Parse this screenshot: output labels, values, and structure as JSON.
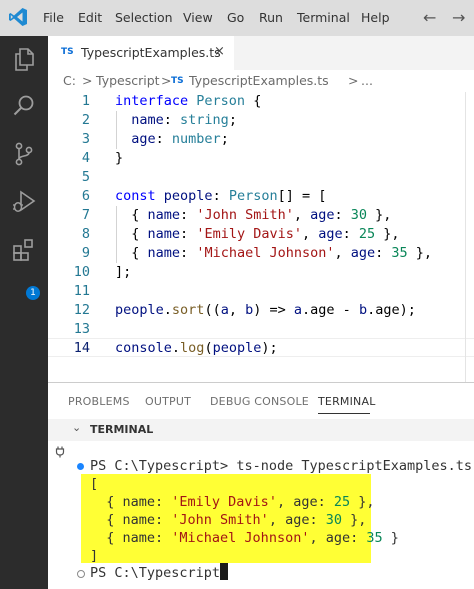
{
  "menu": {
    "items": [
      "File",
      "Edit",
      "Selection",
      "View",
      "Go",
      "Run",
      "Terminal",
      "Help"
    ],
    "back_icon": "arrow-left-icon",
    "forward_icon": "arrow-right-icon"
  },
  "activity_bar": {
    "icons": [
      "files-icon",
      "search-icon",
      "source-control-icon",
      "run-debug-icon",
      "extensions-icon"
    ],
    "extensions_badge": "1"
  },
  "tab": {
    "badge": "TS",
    "label": "TypescriptExamples.ts",
    "close": "×"
  },
  "breadcrumb": {
    "root": "C:",
    "sep": ">",
    "folder": "Typescript",
    "file_badge": "TS",
    "file": "TypescriptExamples.ts",
    "ellipsis": "..."
  },
  "editor": {
    "line_numbers": [
      "1",
      "2",
      "3",
      "4",
      "5",
      "6",
      "7",
      "8",
      "9",
      "10",
      "11",
      "12",
      "13",
      "14"
    ],
    "code": {
      "l1_kw": "interface",
      "l1_name": "Person",
      "l1_brace": " {",
      "l2_prop": "name",
      "l2_colon": ": ",
      "l2_type": "string",
      "l2_end": ";",
      "l3_prop": "age",
      "l3_colon": ": ",
      "l3_type": "number",
      "l3_end": ";",
      "l4": "}",
      "l6_kw": "const",
      "l6_name": "people",
      "l6_colon": ": ",
      "l6_type": "Person",
      "l6_rest": "[] = [",
      "rows": [
        {
          "name": "'John Smith'",
          "age": "30"
        },
        {
          "name": "'Emily Davis'",
          "age": "25"
        },
        {
          "name": "'Michael Johnson'",
          "age": "35"
        }
      ],
      "row_open": "{ ",
      "row_name_key": "name",
      "row_sep1": ": ",
      "row_sep2": ", ",
      "row_age_key": "age",
      "row_sep3": ": ",
      "row_close": " },",
      "l10": "];",
      "l12_obj": "people",
      "l12_dot": ".",
      "l12_fn": "sort",
      "l12_open": "((",
      "l12_a": "a",
      "l12_comma": ", ",
      "l12_b": "b",
      "l12_arrow": ") => ",
      "l12_expr_a": "a",
      "l12_expr_age1": ".age - ",
      "l12_expr_b": "b",
      "l12_expr_age2": ".age",
      "l12_end": ");",
      "l14_obj": "console",
      "l14_dot": ".",
      "l14_fn": "log",
      "l14_open": "(",
      "l14_arg": "people",
      "l14_end": ");"
    }
  },
  "panel": {
    "tabs": [
      "PROBLEMS",
      "OUTPUT",
      "DEBUG CONSOLE",
      "TERMINAL"
    ],
    "active_tab": "TERMINAL",
    "section_title": "TERMINAL",
    "terminal": {
      "prompt1": "PS C:\\Typescript> ",
      "command": "ts-node TypescriptExamples.ts",
      "open_bracket": "[",
      "rows": [
        {
          "name": "'Emily Davis'",
          "age": "25",
          "trail": " },"
        },
        {
          "name": "'John Smith'",
          "age": "30",
          "trail": " },"
        },
        {
          "name": "'Michael Johnson'",
          "age": "35",
          "trail": " }"
        }
      ],
      "row_prefix": "  { name: ",
      "row_mid": ", age: ",
      "close_bracket": "]",
      "prompt2": "PS C:\\Typescript> "
    }
  },
  "colors": {
    "activity_bar": "#2c2c2c",
    "titlebar": "#dddddd",
    "highlight": "#ffff35",
    "accent": "#0078d4"
  }
}
